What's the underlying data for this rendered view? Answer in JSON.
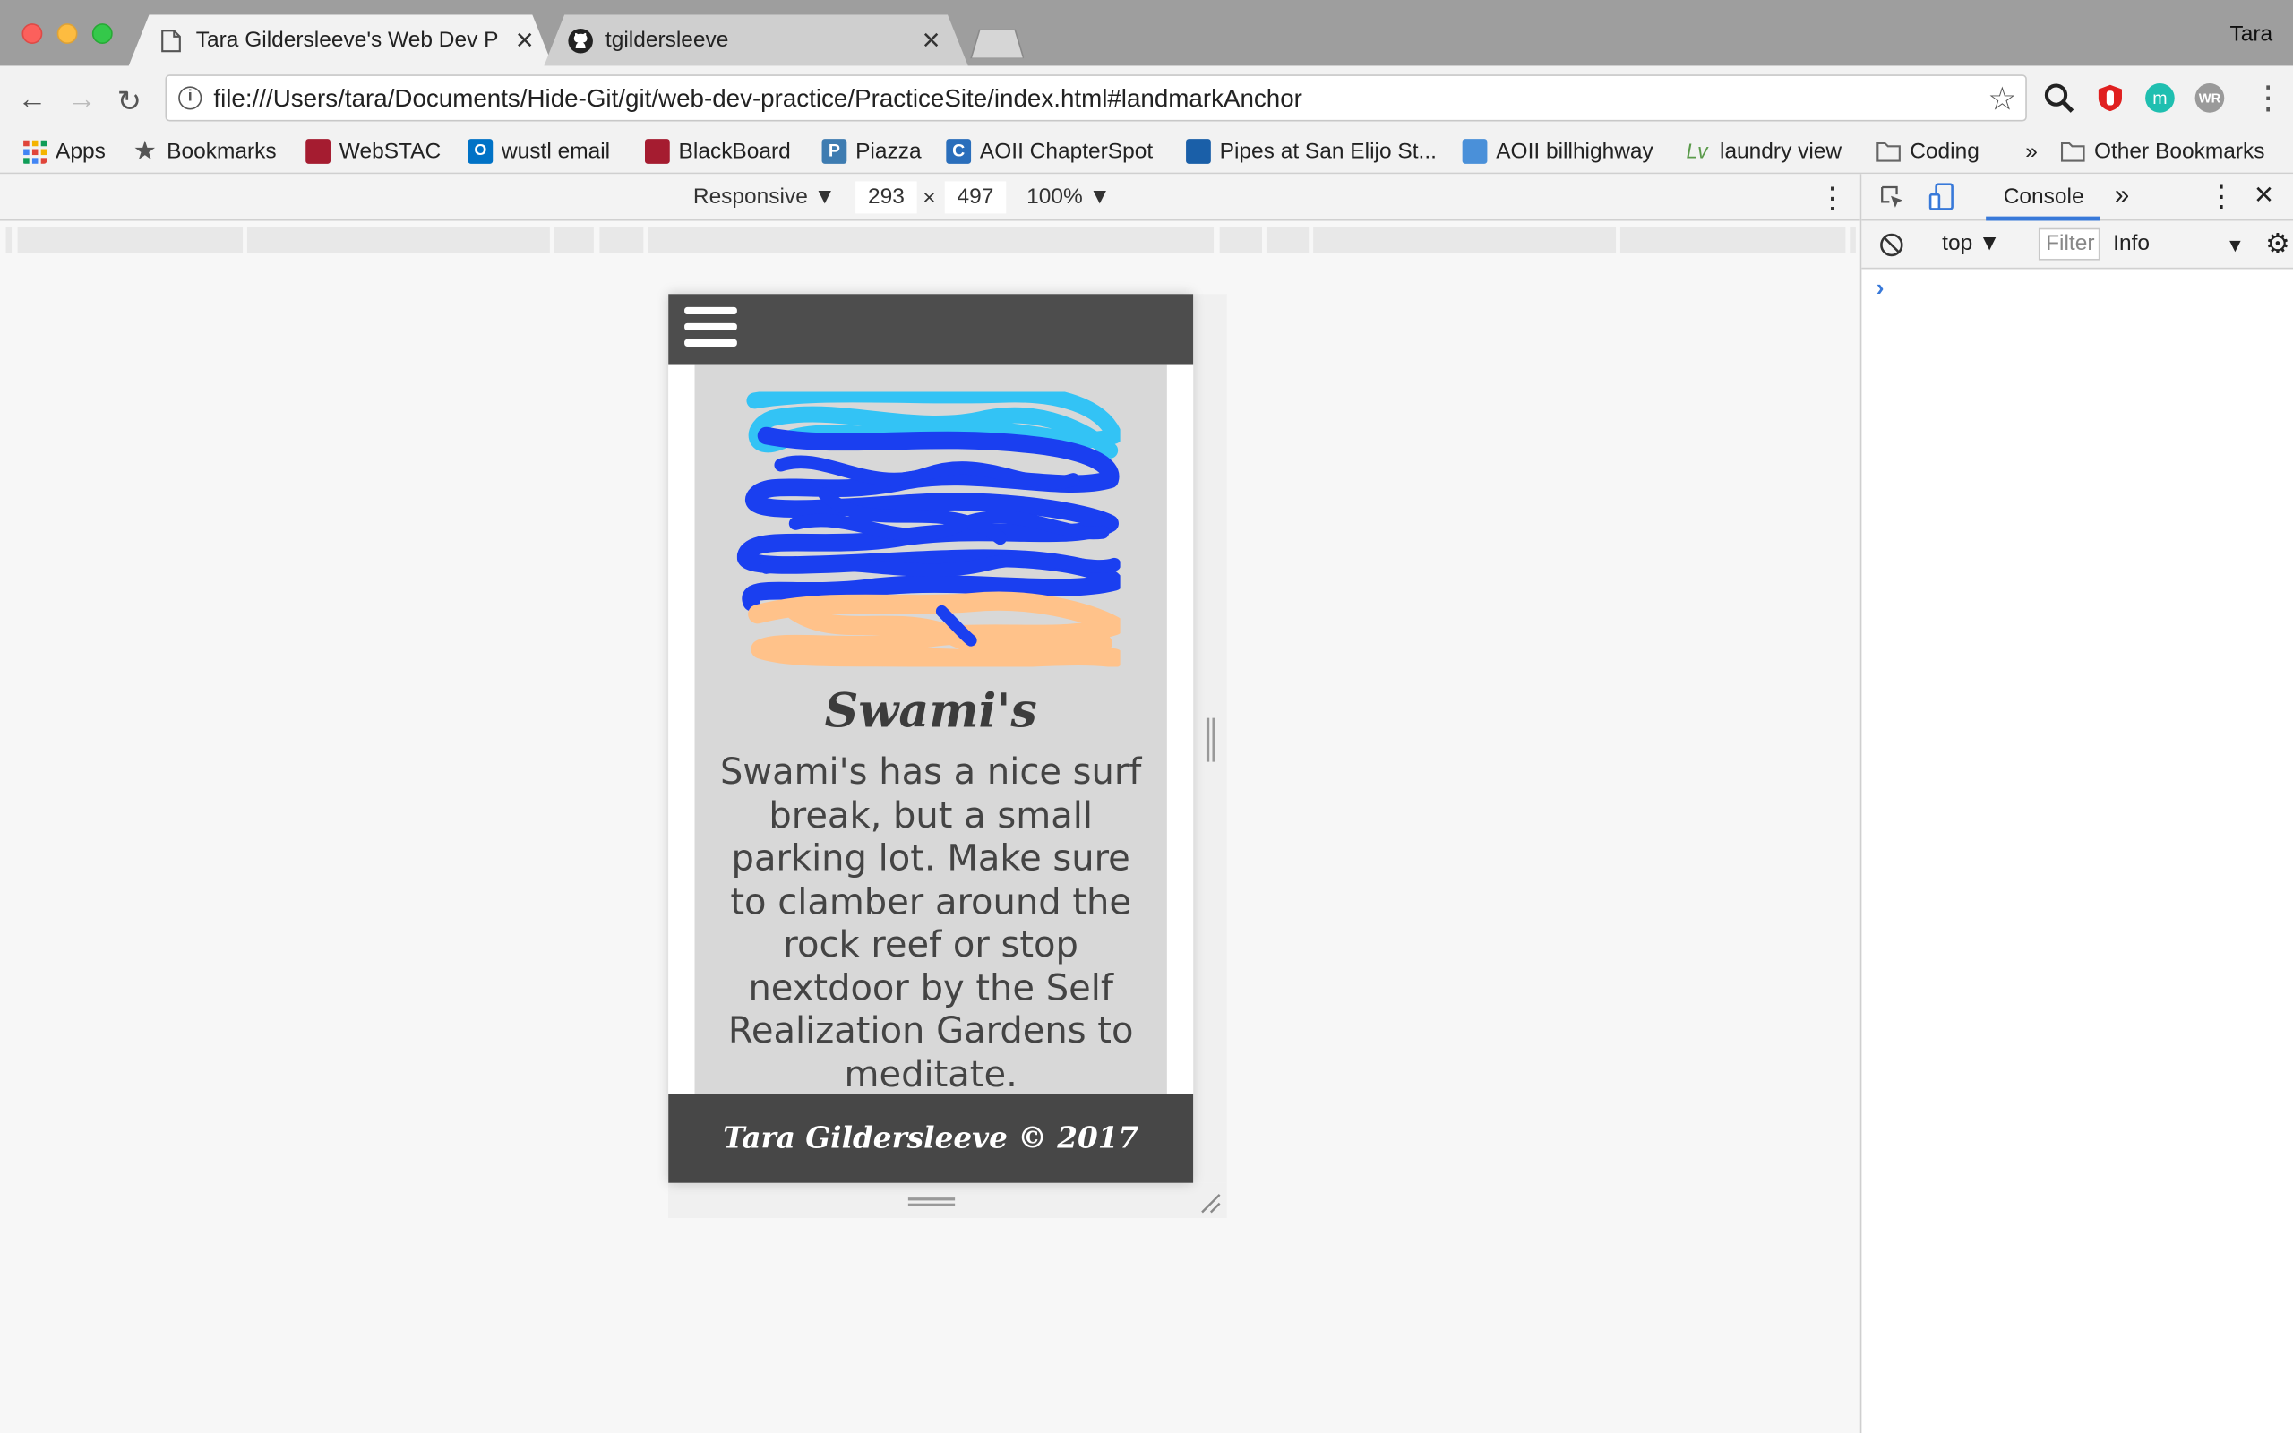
{
  "browser": {
    "profile_name": "Tara",
    "tabs": [
      {
        "label": "Tara Gildersleeve's Web Dev P",
        "active": true,
        "icon": "page-icon"
      },
      {
        "label": "tgildersleeve",
        "active": false,
        "icon": "github-icon"
      }
    ],
    "url": "file:///Users/tara/Documents/Hide-Git/git/web-dev-practice/PracticeSite/index.html#landmarkAnchor",
    "bookmarks": [
      {
        "label": "Apps",
        "icon": "apps-grid-icon",
        "color": "#e0453a"
      },
      {
        "label": "Bookmarks",
        "icon": "star-icon",
        "color": "#555555"
      },
      {
        "label": "WebSTAC",
        "icon": "webstac-icon",
        "color": "#a51c30"
      },
      {
        "label": "wustl email",
        "icon": "outlook-icon",
        "color": "#0072c6"
      },
      {
        "label": "BlackBoard",
        "icon": "blackboard-icon",
        "color": "#a51c30"
      },
      {
        "label": "Piazza",
        "icon": "piazza-icon",
        "color": "#3e7cb1"
      },
      {
        "label": "AOII ChapterSpot",
        "icon": "chapterspot-icon",
        "color": "#2a6ebb"
      },
      {
        "label": "Pipes at San Elijo St...",
        "icon": "surfline-icon",
        "color": "#1a5fa8"
      },
      {
        "label": "AOII billhighway",
        "icon": "billhighway-icon",
        "color": "#4a90d9"
      },
      {
        "label": "laundry view",
        "icon": "laundry-icon",
        "color": "#5a9a4a"
      },
      {
        "label": "Coding",
        "icon": "folder-icon",
        "color": "#666666"
      }
    ],
    "overflow_chevron": "»",
    "other_bookmarks": "Other Bookmarks"
  },
  "device_toolbar": {
    "mode": "Responsive",
    "width": "293",
    "height": "497",
    "times": "×",
    "zoom": "100%"
  },
  "site": {
    "title": "Swami's",
    "description": "Swami's has a nice surf break, but a small parking lot. Make sure to clamber around the rock reef or stop nextdoor by the Self Realization Gardens to meditate.",
    "footer": "Tara Gildersleeve © 2017",
    "colors": {
      "header": "#4d4d4d",
      "content_bg": "#d8d8d8",
      "footer": "#474747",
      "scribble_light_blue": "#33c3f5",
      "scribble_blue": "#1a3ff0",
      "scribble_peach": "#ffc28a"
    }
  },
  "devtools": {
    "tab_console": "Console",
    "more_tabs": "»",
    "context": "top",
    "filter_placeholder": "Filter",
    "level": "Info",
    "prompt": "›"
  }
}
